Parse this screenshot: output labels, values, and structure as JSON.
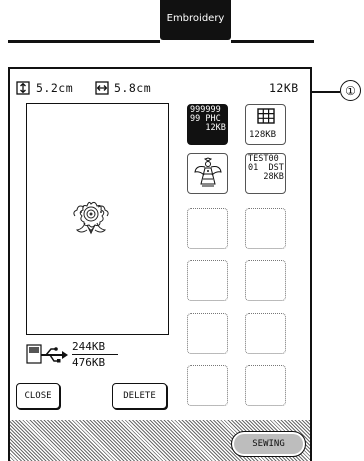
{
  "mode_tab": {
    "label": "Embroidery"
  },
  "info_bar": {
    "height_value": "5.2cm",
    "width_value": "5.8cm",
    "file_size": "12KB"
  },
  "memory": {
    "used": "244KB",
    "free": "476KB"
  },
  "tiles": {
    "t1": "999999\n99 PHC\n   12KB",
    "t2_size": "128KB",
    "t4": "TEST00\n01  DST\n   28KB"
  },
  "buttons": {
    "close": "CLOSE",
    "delete": "DELETE",
    "sewing": "SEWING"
  },
  "callout": {
    "number": "①"
  }
}
